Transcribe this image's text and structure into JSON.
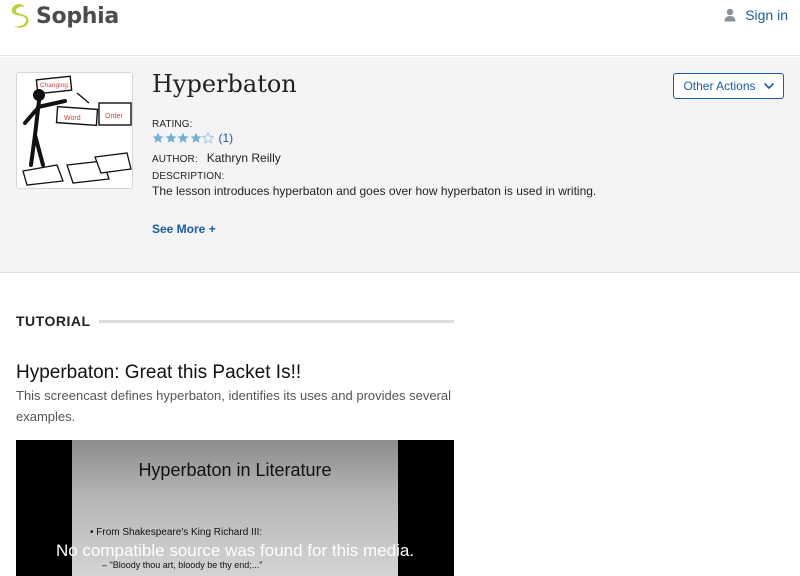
{
  "header": {
    "brand": "Sophia",
    "signin_label": "Sign in"
  },
  "lesson": {
    "title": "Hyperbaton",
    "rating_label": "RATING:",
    "rating": {
      "stars_filled": 4,
      "stars_total": 5,
      "count_text": "(1)"
    },
    "author_label": "AUTHOR:",
    "author": "Kathryn Reilly",
    "description_label": "DESCRIPTION:",
    "description": "The lesson introduces hyperbaton and goes over how hyperbaton is used in writing.",
    "see_more": "See More +",
    "other_actions": "Other Actions",
    "thumbnail_words": [
      "Changing",
      "Word",
      "Order"
    ]
  },
  "tutorial": {
    "heading": "TUTORIAL",
    "title": "Hyperbaton: Great this Packet Is!!",
    "description": "This screencast defines hyperbaton, identifies its uses and provides several examples."
  },
  "video": {
    "slide_title": "Hyperbaton in Literature",
    "slide_bullet": "From Shakespeare's King Richard III:",
    "slide_sub": "– \"Bloody thou art, bloody be thy end;...\"",
    "message": "No compatible source was found for this media."
  },
  "colors": {
    "link": "#1a5aa6",
    "star": "#6fb0d8",
    "logo_green": "#b5d334",
    "band_bg": "#f4f4f4"
  }
}
